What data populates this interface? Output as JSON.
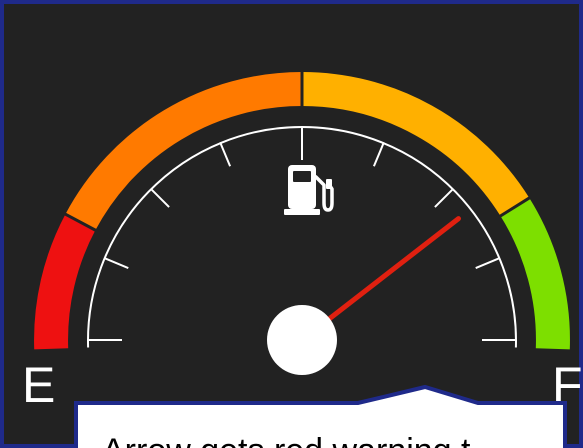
{
  "gauge": {
    "empty_label": "E",
    "full_label": "F",
    "fuel_level_fraction": 0.79,
    "icon": "fuel-pump-icon",
    "colors": {
      "background": "#222222",
      "frame": "#1f2a8a",
      "zone_red": "#ee1111",
      "zone_orange": "#ff7a00",
      "zone_amber": "#ffb000",
      "zone_green": "#7ddf00",
      "needle": "#e02010",
      "ticks": "#ffffff",
      "hub": "#ffffff"
    }
  },
  "callout": {
    "text": "Arrow gets red warning t"
  }
}
